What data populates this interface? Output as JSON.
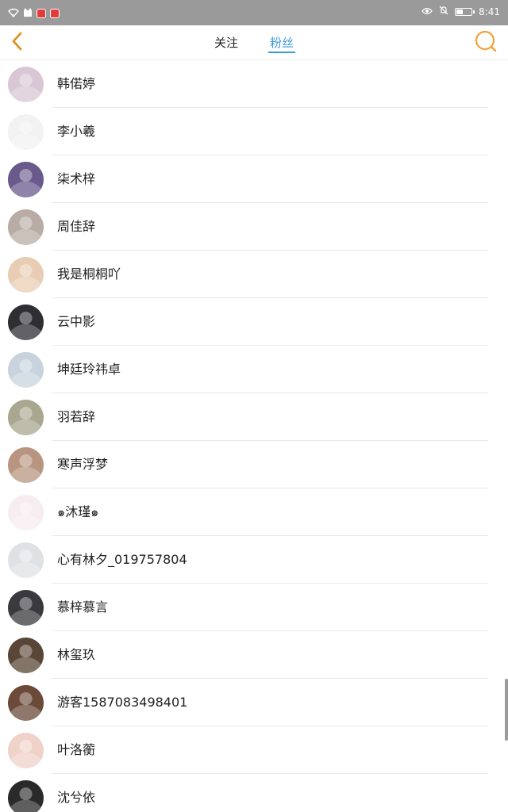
{
  "status_bar": {
    "time": "8:41",
    "battery_level": 0.45,
    "icons": [
      "wifi-icon",
      "cat-app-icon",
      "app-badge-icon",
      "app-badge-icon",
      "eye-icon",
      "bell-off-icon",
      "battery-icon"
    ]
  },
  "header": {
    "tabs": [
      {
        "label": "关注",
        "active": false
      },
      {
        "label": "粉丝",
        "active": true
      }
    ],
    "back_icon": "chevron-left-icon",
    "search_icon": "search-icon",
    "colors": {
      "accent": "#3a9bd8",
      "icon": "#f0a23b"
    }
  },
  "followers": [
    {
      "name": "韩偌婷",
      "avatar_color": "#d9c7d6"
    },
    {
      "name": "李小羲",
      "avatar_color": "#f2f2f2"
    },
    {
      "name": "柒术梓",
      "avatar_color": "#6a5a8c"
    },
    {
      "name": "周佳辞",
      "avatar_color": "#b8aca4"
    },
    {
      "name": "我是桐桐吖",
      "avatar_color": "#e8cdb4"
    },
    {
      "name": "云中影",
      "avatar_color": "#2e2e33"
    },
    {
      "name": "坤廷玲祎卓",
      "avatar_color": "#c9d3de"
    },
    {
      "name": "羽若辞",
      "avatar_color": "#a9a78f"
    },
    {
      "name": "寒声浮梦",
      "avatar_color": "#b89580"
    },
    {
      "name": "๑沐瑾๑",
      "avatar_color": "#f7ecef"
    },
    {
      "name": "心有林夕_019757804",
      "avatar_color": "#dfe2e4"
    },
    {
      "name": "慕梓慕言",
      "avatar_color": "#3a3a3e"
    },
    {
      "name": "林玺玖",
      "avatar_color": "#5a4636"
    },
    {
      "name": "游客1587083498401",
      "avatar_color": "#6b4a3a"
    },
    {
      "name": "叶洛蘅",
      "avatar_color": "#efd2c8"
    },
    {
      "name": "沈兮依",
      "avatar_color": "#2a2a2a"
    }
  ]
}
